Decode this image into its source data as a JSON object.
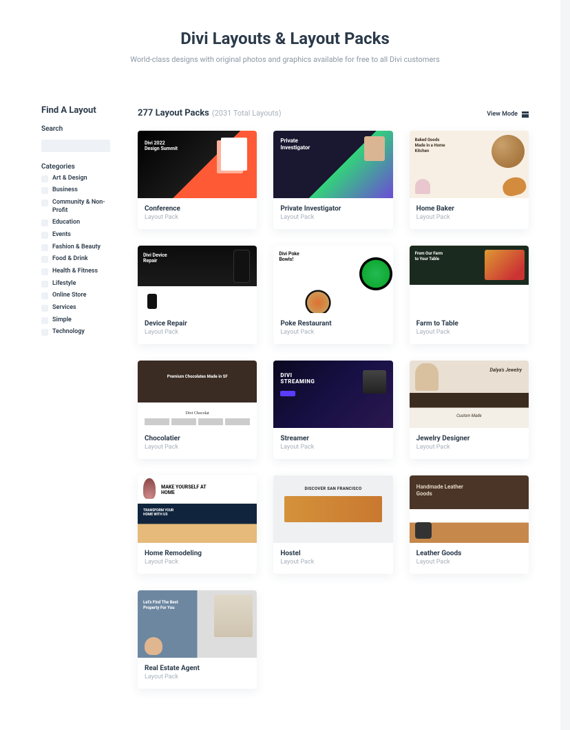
{
  "hero": {
    "title": "Divi Layouts & Layout Packs",
    "subtitle": "World-class designs with original photos and graphics available for free to all Divi customers"
  },
  "sidebar": {
    "title": "Find A Layout",
    "search_label": "Search",
    "search_placeholder": "",
    "categories_label": "Categories",
    "categories": [
      "Art & Design",
      "Business",
      "Community & Non-Profit",
      "Education",
      "Events",
      "Fashion & Beauty",
      "Food & Drink",
      "Health & Fitness",
      "Lifestyle",
      "Online Store",
      "Services",
      "Simple",
      "Technology"
    ]
  },
  "main": {
    "count": "277 Layout Packs",
    "total": "(2031 Total Layouts)",
    "view_mode_label": "View Mode"
  },
  "cards": [
    {
      "title": "Conference",
      "subtitle": "Layout Pack",
      "thumb": "th-conference"
    },
    {
      "title": "Private Investigator",
      "subtitle": "Layout Pack",
      "thumb": "th-pi"
    },
    {
      "title": "Home Baker",
      "subtitle": "Layout Pack",
      "thumb": "th-baker"
    },
    {
      "title": "Device Repair",
      "subtitle": "Layout Pack",
      "thumb": "th-device"
    },
    {
      "title": "Poke Restaurant",
      "subtitle": "Layout Pack",
      "thumb": "th-poke"
    },
    {
      "title": "Farm to Table",
      "subtitle": "Layout Pack",
      "thumb": "th-farm"
    },
    {
      "title": "Chocolatier",
      "subtitle": "Layout Pack",
      "thumb": "th-choc"
    },
    {
      "title": "Streamer",
      "subtitle": "Layout Pack",
      "thumb": "th-stream"
    },
    {
      "title": "Jewelry Designer",
      "subtitle": "Layout Pack",
      "thumb": "th-jewel"
    },
    {
      "title": "Home Remodeling",
      "subtitle": "Layout Pack",
      "thumb": "th-remodel"
    },
    {
      "title": "Hostel",
      "subtitle": "Layout Pack",
      "thumb": "th-hostel"
    },
    {
      "title": "Leather Goods",
      "subtitle": "Layout Pack",
      "thumb": "th-leather"
    },
    {
      "title": "Real Estate Agent",
      "subtitle": "Layout Pack",
      "thumb": "th-realestate"
    }
  ]
}
